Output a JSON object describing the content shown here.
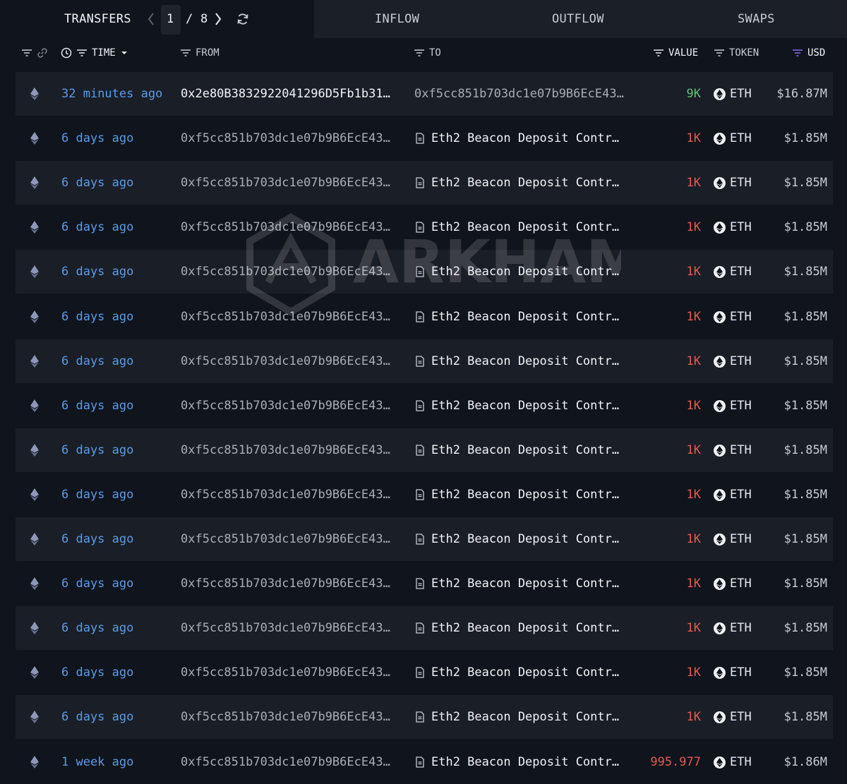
{
  "topbar": {
    "transfers_label": "TRANSFERS",
    "page_current": "1",
    "page_sep": "/",
    "page_total": "8",
    "tabs": [
      "INFLOW",
      "OUTFLOW",
      "SWAPS"
    ]
  },
  "header": {
    "time": "TIME",
    "from": "FROM",
    "to": "TO",
    "value": "VALUE",
    "token": "TOKEN",
    "usd": "USD"
  },
  "watermark": "ARKHAM",
  "colors": {
    "background": "#10141c",
    "row_alt": "#1a1e26",
    "time_link": "#5c9be8",
    "inflow_value": "#5fc273",
    "outflow_value": "#e15b53",
    "usd_sort_accent": "#8b6cf0"
  },
  "icons": {
    "filter": "filter-icon",
    "link": "link-icon",
    "clock": "clock-icon",
    "refresh": "refresh-icon",
    "chain": "ethereum-icon",
    "contract": "document-icon",
    "token": "eth-token-icon"
  },
  "rows": [
    {
      "time": "32 minutes ago",
      "from": "0x2e80B3832922041296D5Fb1b31…",
      "to": "0xf5cc851b703dc1e07b9B6EcE43…",
      "value": "9K",
      "token": "ETH",
      "usd": "$16.87M"
    },
    {
      "time": "6 days ago",
      "from": "0xf5cc851b703dc1e07b9B6EcE43…",
      "to": "Eth2 Beacon Deposit Contr…",
      "value": "1K",
      "token": "ETH",
      "usd": "$1.85M"
    },
    {
      "time": "6 days ago",
      "from": "0xf5cc851b703dc1e07b9B6EcE43…",
      "to": "Eth2 Beacon Deposit Contr…",
      "value": "1K",
      "token": "ETH",
      "usd": "$1.85M"
    },
    {
      "time": "6 days ago",
      "from": "0xf5cc851b703dc1e07b9B6EcE43…",
      "to": "Eth2 Beacon Deposit Contr…",
      "value": "1K",
      "token": "ETH",
      "usd": "$1.85M"
    },
    {
      "time": "6 days ago",
      "from": "0xf5cc851b703dc1e07b9B6EcE43…",
      "to": "Eth2 Beacon Deposit Contr…",
      "value": "1K",
      "token": "ETH",
      "usd": "$1.85M"
    },
    {
      "time": "6 days ago",
      "from": "0xf5cc851b703dc1e07b9B6EcE43…",
      "to": "Eth2 Beacon Deposit Contr…",
      "value": "1K",
      "token": "ETH",
      "usd": "$1.85M"
    },
    {
      "time": "6 days ago",
      "from": "0xf5cc851b703dc1e07b9B6EcE43…",
      "to": "Eth2 Beacon Deposit Contr…",
      "value": "1K",
      "token": "ETH",
      "usd": "$1.85M"
    },
    {
      "time": "6 days ago",
      "from": "0xf5cc851b703dc1e07b9B6EcE43…",
      "to": "Eth2 Beacon Deposit Contr…",
      "value": "1K",
      "token": "ETH",
      "usd": "$1.85M"
    },
    {
      "time": "6 days ago",
      "from": "0xf5cc851b703dc1e07b9B6EcE43…",
      "to": "Eth2 Beacon Deposit Contr…",
      "value": "1K",
      "token": "ETH",
      "usd": "$1.85M"
    },
    {
      "time": "6 days ago",
      "from": "0xf5cc851b703dc1e07b9B6EcE43…",
      "to": "Eth2 Beacon Deposit Contr…",
      "value": "1K",
      "token": "ETH",
      "usd": "$1.85M"
    },
    {
      "time": "6 days ago",
      "from": "0xf5cc851b703dc1e07b9B6EcE43…",
      "to": "Eth2 Beacon Deposit Contr…",
      "value": "1K",
      "token": "ETH",
      "usd": "$1.85M"
    },
    {
      "time": "6 days ago",
      "from": "0xf5cc851b703dc1e07b9B6EcE43…",
      "to": "Eth2 Beacon Deposit Contr…",
      "value": "1K",
      "token": "ETH",
      "usd": "$1.85M"
    },
    {
      "time": "6 days ago",
      "from": "0xf5cc851b703dc1e07b9B6EcE43…",
      "to": "Eth2 Beacon Deposit Contr…",
      "value": "1K",
      "token": "ETH",
      "usd": "$1.85M"
    },
    {
      "time": "6 days ago",
      "from": "0xf5cc851b703dc1e07b9B6EcE43…",
      "to": "Eth2 Beacon Deposit Contr…",
      "value": "1K",
      "token": "ETH",
      "usd": "$1.85M"
    },
    {
      "time": "6 days ago",
      "from": "0xf5cc851b703dc1e07b9B6EcE43…",
      "to": "Eth2 Beacon Deposit Contr…",
      "value": "1K",
      "token": "ETH",
      "usd": "$1.85M"
    },
    {
      "time": "1 week ago",
      "from": "0xf5cc851b703dc1e07b9B6EcE43…",
      "to": "Eth2 Beacon Deposit Contr…",
      "value": "995.977",
      "token": "ETH",
      "usd": "$1.86M"
    }
  ]
}
